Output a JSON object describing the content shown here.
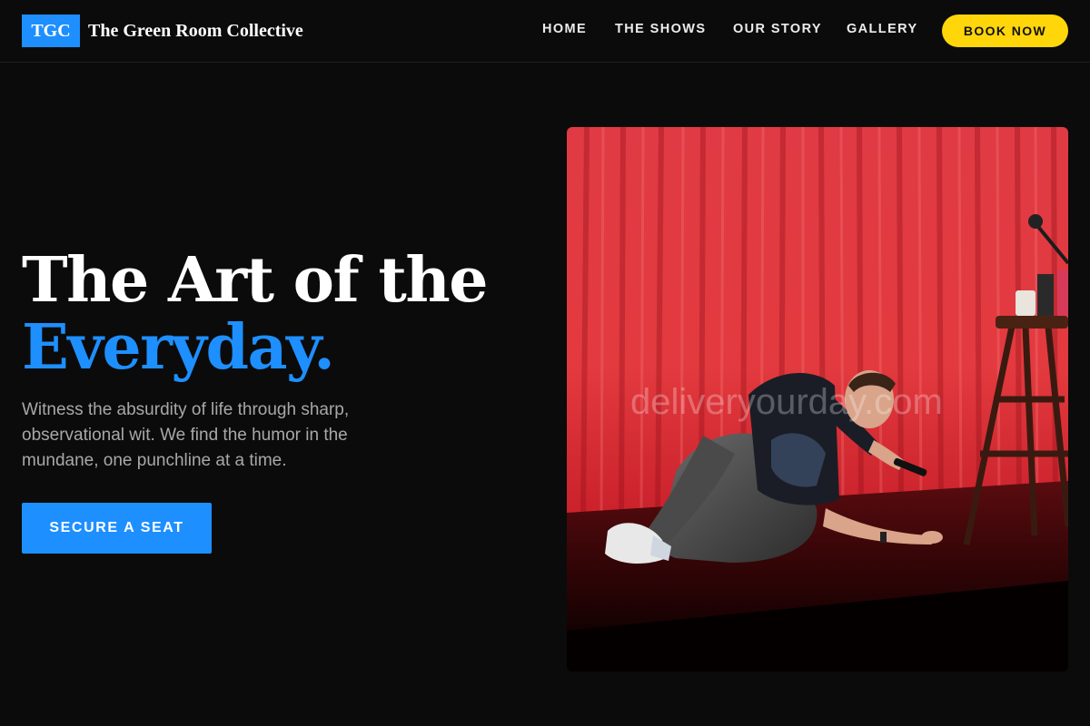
{
  "header": {
    "logo_mark": "TGC",
    "brand_name": "The Green Room Collective",
    "nav": [
      "HOME",
      "THE SHOWS",
      "OUR STORY",
      "GALLERY"
    ],
    "book_label": "BOOK NOW"
  },
  "hero": {
    "title_line1": "The Art of the",
    "title_line2": "Everyday.",
    "description": "Witness the absurdity of life through sharp, observational wit. We find the humor in the mundane, one punchline at a time.",
    "cta_label": "SECURE A SEAT",
    "image": {
      "subject": "comedian on stage in front of red curtain",
      "watermark": "deliveryourday.com"
    }
  },
  "colors": {
    "background": "#0b0b0b",
    "accent_blue": "#1e8fff",
    "accent_yellow": "#ffd60a",
    "curtain_red": "#e0303a"
  }
}
